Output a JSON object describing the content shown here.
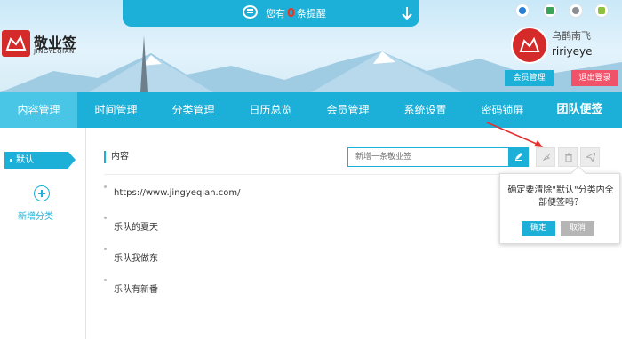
{
  "header": {
    "notice_prefix": "您有",
    "notice_count": "0",
    "notice_suffix": "条提醒",
    "os_icons": [
      "ie-icon",
      "windows-icon",
      "apple-icon",
      "android-icon"
    ],
    "logo_name": "敬业签",
    "logo_sub": "JINGYEQIAN",
    "user_name": "乌鹊南飞",
    "user_id": "ririyeye",
    "member_button": "会员管理",
    "logout_button": "退出登录"
  },
  "nav": {
    "items": [
      "内容管理",
      "时间管理",
      "分类管理",
      "日历总览",
      "会员管理",
      "系统设置",
      "密码锁屏",
      "团队便签"
    ],
    "active_index": 0
  },
  "sidebar": {
    "default_category": "默认",
    "add_category": "新增分类"
  },
  "main": {
    "section_title": "内容",
    "new_note_placeholder": "新增一条敬业签",
    "notes": [
      "https://www.jingyeqian.com/",
      "乐队的夏天",
      "乐队我做东",
      "乐队有新番"
    ]
  },
  "popover": {
    "message": "确定要清除\"默认\"分类内全部便签吗？",
    "confirm": "确定",
    "cancel": "取消"
  },
  "colors": {
    "accent": "#1cb0d8",
    "brand_red": "#d42a2a",
    "logout": "#f0526a"
  }
}
